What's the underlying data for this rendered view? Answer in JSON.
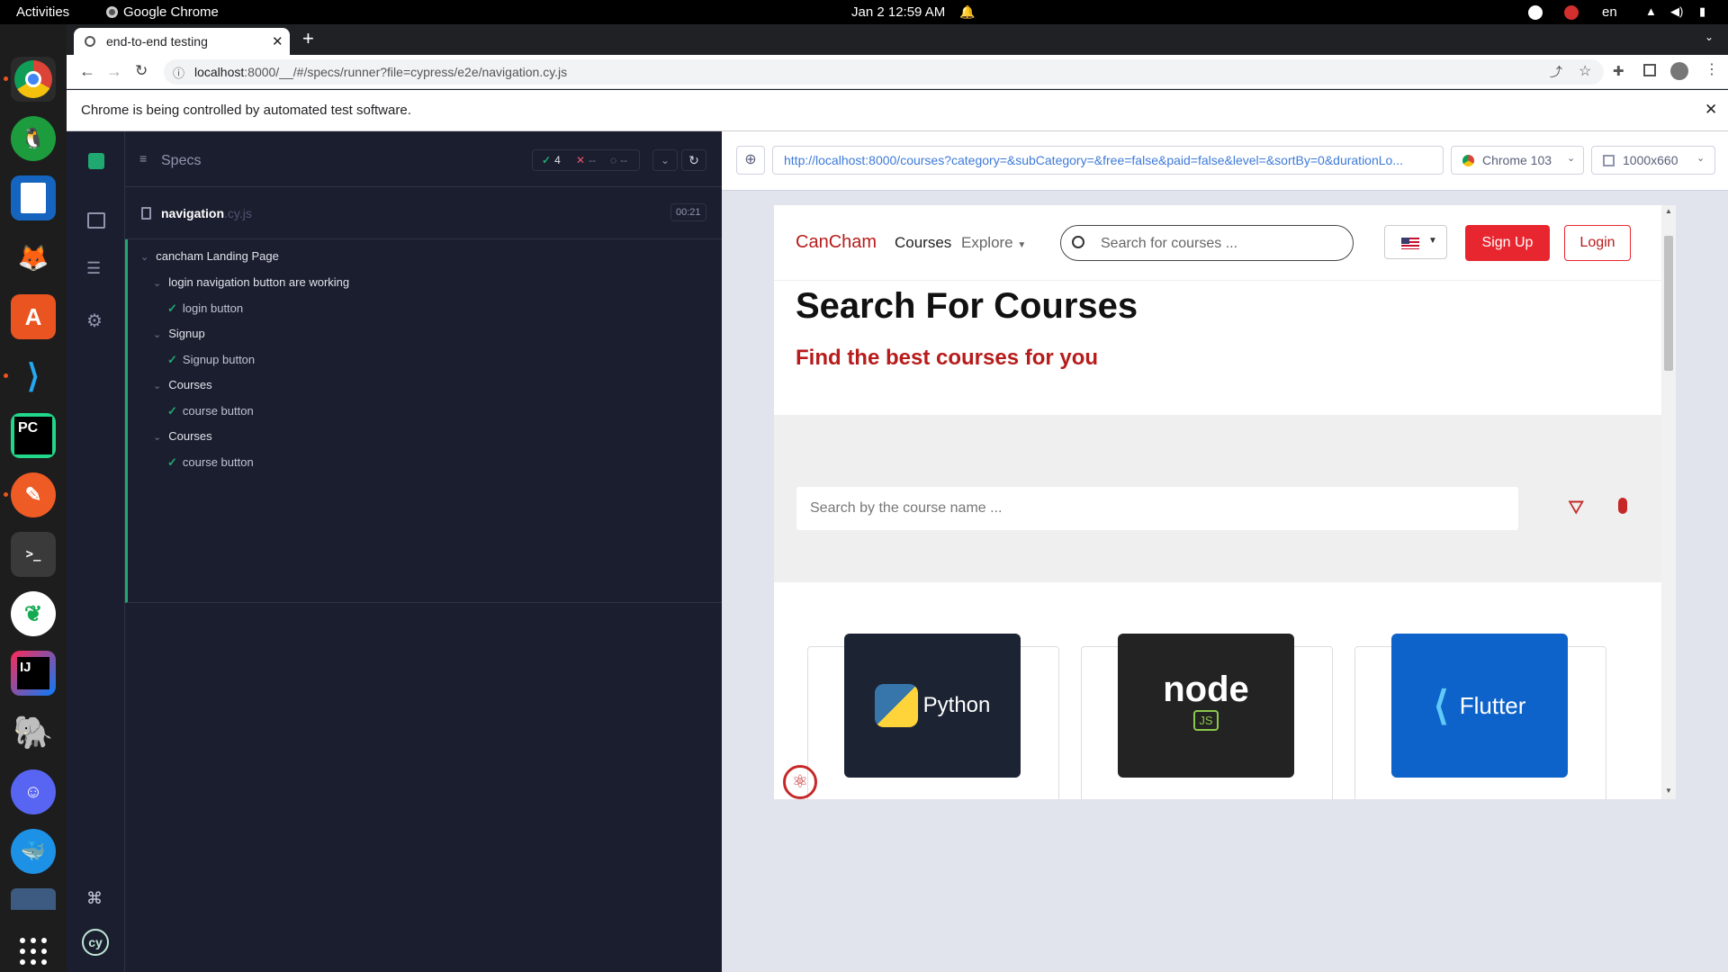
{
  "topbar": {
    "activities": "Activities",
    "app_name": "Google Chrome",
    "datetime": "Jan 2  12:59 AM",
    "lang": "en"
  },
  "dock": {
    "apps": [
      "chrome-icon",
      "alarm-clock-icon",
      "writer-icon",
      "gimp-icon",
      "app-center-icon",
      "vscode-icon",
      "pycharm-icon",
      "postman-icon",
      "terminal-icon",
      "mongodb-icon",
      "intellij-icon",
      "postgres-icon",
      "discord-icon",
      "docker-icon",
      "mysql-workbench-icon",
      "show-apps-icon"
    ]
  },
  "browser": {
    "tab_title": "end-to-end testing",
    "url_host": "localhost",
    "url_rest": ":8000/__/#/specs/runner?file=cypress/e2e/navigation.cy.js",
    "infobar_text": "Chrome is being controlled by automated test software."
  },
  "cypress": {
    "specs_label": "Specs",
    "pass_count": "4",
    "fail_count": "--",
    "pending_count": "--",
    "spec_name": "navigation",
    "spec_ext": ".cy.js",
    "duration": "00:21",
    "suite": "cancham Landing Page",
    "tests": [
      {
        "group": "login navigation button are working",
        "test": "login button"
      },
      {
        "group": "Signup",
        "test": "Signup button"
      },
      {
        "group": "Courses",
        "test": "course button"
      },
      {
        "group": "Courses",
        "test": "course button"
      }
    ],
    "aut_url": "http://localhost:8000/courses?category=&subCategory=&free=false&paid=false&level=&sortBy=0&durationLo...",
    "browser_label": "Chrome 103",
    "viewport_label": "1000x660"
  },
  "app": {
    "brand": "CanCham",
    "nav_courses": "Courses",
    "nav_explore": "Explore",
    "search_placeholder": "Search for courses ...",
    "signup": "Sign Up",
    "login": "Login",
    "heading": "Search For Courses",
    "subheading": "Find the best courses for you",
    "course_search_placeholder": "Search by the course name ...",
    "cards": [
      {
        "label": "Python",
        "bg": "#1c2433"
      },
      {
        "label": "node",
        "sublabel": "JS",
        "bg": "#232323"
      },
      {
        "label": "Flutter",
        "bg": "#0d63c9"
      }
    ],
    "brand_color": "#b71c1c",
    "accent_red": "#e8262f"
  }
}
